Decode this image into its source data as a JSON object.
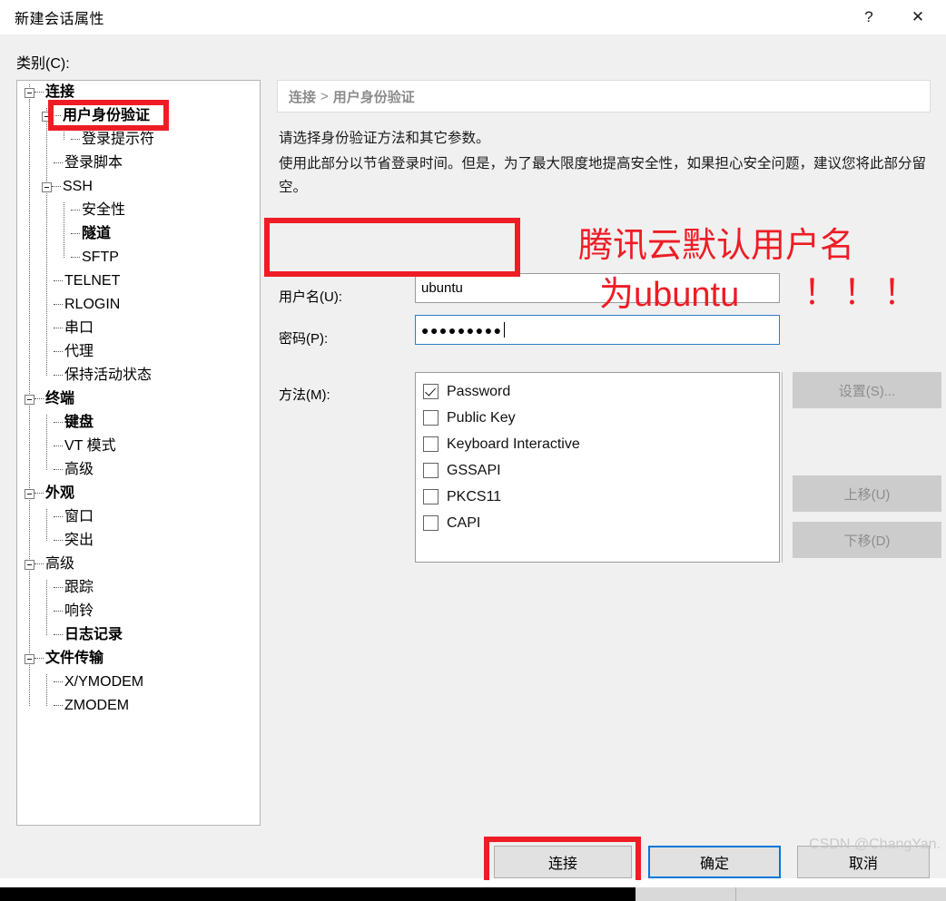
{
  "window": {
    "title": "新建会话属性",
    "help_button": "?",
    "close_button": "✕"
  },
  "category": {
    "label": "类别(C):",
    "tree": [
      {
        "label": "连接",
        "level": 0,
        "bold": true,
        "expander": true,
        "selected": false
      },
      {
        "label": "用户身份验证",
        "level": 1,
        "bold": true,
        "expander": true,
        "selected": true
      },
      {
        "label": "登录提示符",
        "level": 2,
        "bold": false,
        "expander": false,
        "selected": false
      },
      {
        "label": "登录脚本",
        "level": 1,
        "bold": false,
        "expander": false,
        "selected": false
      },
      {
        "label": "SSH",
        "level": 1,
        "bold": false,
        "expander": true,
        "selected": false
      },
      {
        "label": "安全性",
        "level": 2,
        "bold": false,
        "expander": false,
        "selected": false
      },
      {
        "label": "隧道",
        "level": 2,
        "bold": true,
        "expander": false,
        "selected": false
      },
      {
        "label": "SFTP",
        "level": 2,
        "bold": false,
        "expander": false,
        "selected": false
      },
      {
        "label": "TELNET",
        "level": 1,
        "bold": false,
        "expander": false,
        "selected": false
      },
      {
        "label": "RLOGIN",
        "level": 1,
        "bold": false,
        "expander": false,
        "selected": false
      },
      {
        "label": "串口",
        "level": 1,
        "bold": false,
        "expander": false,
        "selected": false
      },
      {
        "label": "代理",
        "level": 1,
        "bold": false,
        "expander": false,
        "selected": false
      },
      {
        "label": "保持活动状态",
        "level": 1,
        "bold": false,
        "expander": false,
        "selected": false
      },
      {
        "label": "终端",
        "level": 0,
        "bold": true,
        "expander": true,
        "selected": false
      },
      {
        "label": "键盘",
        "level": 1,
        "bold": true,
        "expander": false,
        "selected": false
      },
      {
        "label": "VT 模式",
        "level": 1,
        "bold": false,
        "expander": false,
        "selected": false
      },
      {
        "label": "高级",
        "level": 1,
        "bold": false,
        "expander": false,
        "selected": false
      },
      {
        "label": "外观",
        "level": 0,
        "bold": true,
        "expander": true,
        "selected": false
      },
      {
        "label": "窗口",
        "level": 1,
        "bold": false,
        "expander": false,
        "selected": false
      },
      {
        "label": "突出",
        "level": 1,
        "bold": false,
        "expander": false,
        "selected": false
      },
      {
        "label": "高级",
        "level": 0,
        "bold": false,
        "expander": true,
        "selected": false
      },
      {
        "label": "跟踪",
        "level": 1,
        "bold": false,
        "expander": false,
        "selected": false
      },
      {
        "label": "响铃",
        "level": 1,
        "bold": false,
        "expander": false,
        "selected": false
      },
      {
        "label": "日志记录",
        "level": 1,
        "bold": true,
        "expander": false,
        "selected": false
      },
      {
        "label": "文件传输",
        "level": 0,
        "bold": true,
        "expander": true,
        "selected": false
      },
      {
        "label": "X/YMODEM",
        "level": 1,
        "bold": false,
        "expander": false,
        "selected": false
      },
      {
        "label": "ZMODEM",
        "level": 1,
        "bold": false,
        "expander": false,
        "selected": false
      }
    ]
  },
  "panel": {
    "breadcrumb_root": "连接",
    "breadcrumb_sep": ">",
    "breadcrumb_current": "用户身份验证",
    "description_line1": "请选择身份验证方法和其它参数。",
    "description_line2": "使用此部分以节省登录时间。但是，为了最大限度地提高安全性，如果担心安全问题，建议您将此部分留空。",
    "username_label": "用户名(U):",
    "username_value": "ubuntu",
    "password_label": "密码(P):",
    "password_value": "●●●●●●●●●",
    "methods_label": "方法(M):",
    "methods": [
      {
        "label": "Password",
        "checked": true
      },
      {
        "label": "Public Key",
        "checked": false
      },
      {
        "label": "Keyboard Interactive",
        "checked": false
      },
      {
        "label": "GSSAPI",
        "checked": false
      },
      {
        "label": "PKCS11",
        "checked": false
      },
      {
        "label": "CAPI",
        "checked": false
      }
    ],
    "side_buttons": {
      "properties": "设置(S)...",
      "move_up": "上移(U)",
      "move_down": "下移(D)"
    }
  },
  "footer": {
    "connect": "连接",
    "ok": "确定",
    "cancel": "取消",
    "watermark": "CSDN @ChangYan."
  },
  "annotations": {
    "note_line1": "腾讯云默认用户名",
    "note_line2": "为ubuntu",
    "note_line3": "！！！",
    "accent_color": "#ee1c25"
  }
}
